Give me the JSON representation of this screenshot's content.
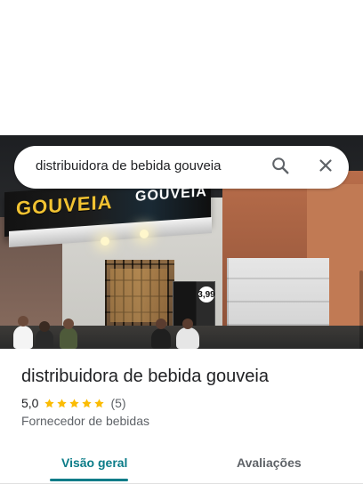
{
  "colors": {
    "accent_teal": "#0b7c88",
    "star_yellow": "#fbbc04",
    "text_primary": "#202124",
    "text_secondary": "#5f6368"
  },
  "search": {
    "query": "distribuidora de bebida gouveia",
    "search_icon": "search-icon",
    "close_icon": "close-icon"
  },
  "photo": {
    "sign_text": "GOUVEIA",
    "sign_text_2": "GOUVEIA",
    "price_badge": "3,99"
  },
  "place": {
    "name": "distribuidora de bebida gouveia",
    "rating": "5,0",
    "stars": 5,
    "review_count": "(5)",
    "category": "Fornecedor de bebidas"
  },
  "tabs": [
    {
      "label": "Visão geral",
      "active": true
    },
    {
      "label": "Avaliações",
      "active": false
    }
  ]
}
